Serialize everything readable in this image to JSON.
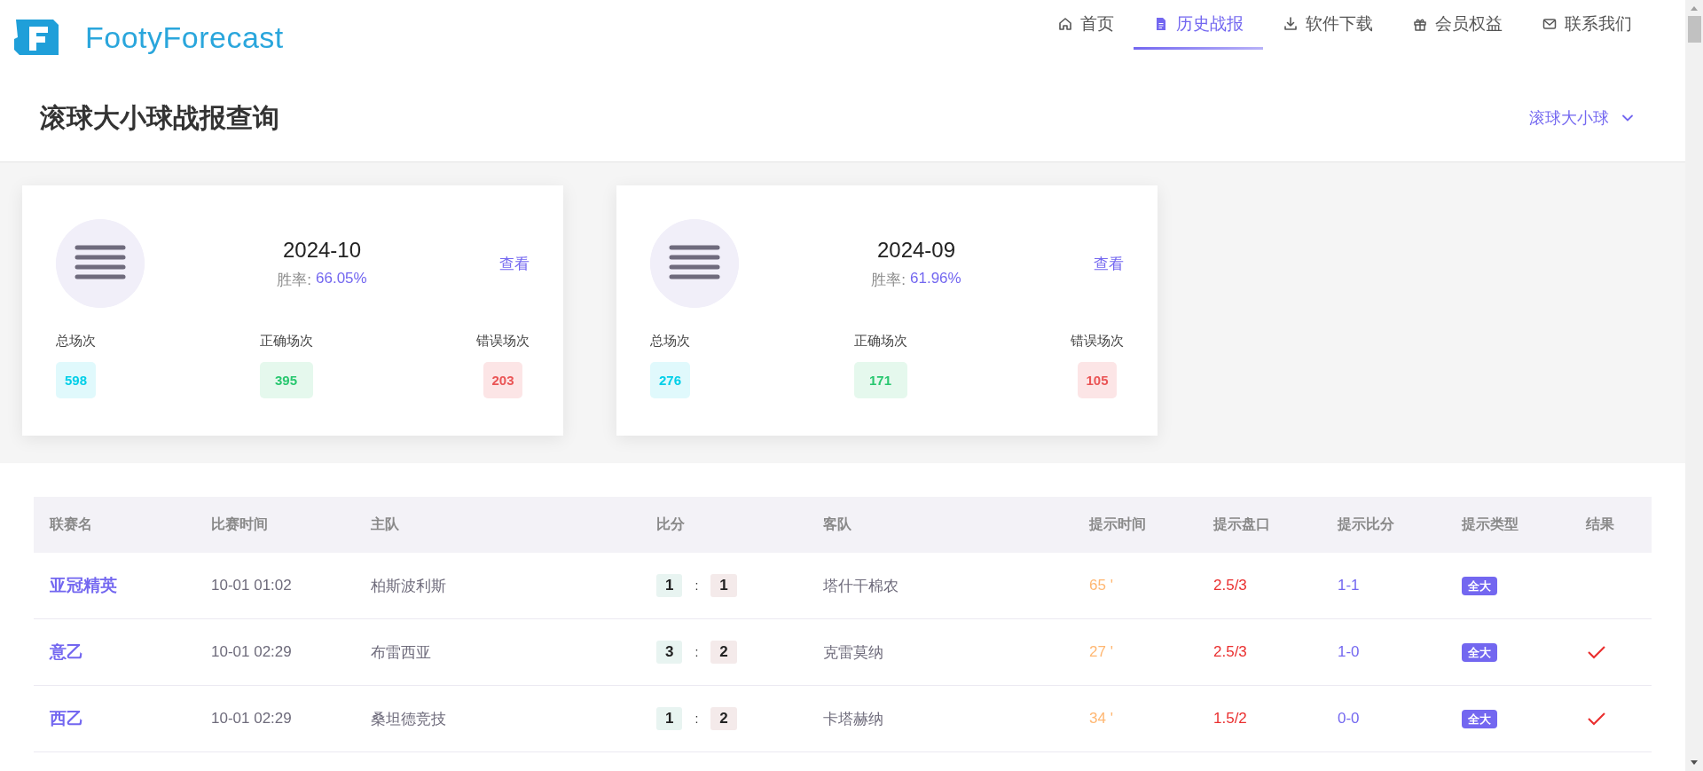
{
  "brand": {
    "name": "FootyForecast"
  },
  "nav": [
    {
      "label": "首页",
      "kind": "home",
      "selected": false
    },
    {
      "label": "历史战报",
      "kind": "doc",
      "selected": true
    },
    {
      "label": "软件下载",
      "kind": "download",
      "selected": false
    },
    {
      "label": "会员权益",
      "kind": "gift",
      "selected": false
    },
    {
      "label": "联系我们",
      "kind": "mail",
      "selected": false
    }
  ],
  "page": {
    "title": "滚球大小球战报查询",
    "dropdown": "滚球大小球"
  },
  "cards": [
    {
      "month": "2024-10",
      "rate_label": "胜率:",
      "rate": "66.05%",
      "link": "查看",
      "stats": [
        {
          "label": "总场次",
          "value": "598",
          "kind": "total"
        },
        {
          "label": "正确场次",
          "value": "395",
          "kind": "correct"
        },
        {
          "label": "错误场次",
          "value": "203",
          "kind": "wrong"
        }
      ]
    },
    {
      "month": "2024-09",
      "rate_label": "胜率:",
      "rate": "61.96%",
      "link": "查看",
      "stats": [
        {
          "label": "总场次",
          "value": "276",
          "kind": "total"
        },
        {
          "label": "正确场次",
          "value": "171",
          "kind": "correct"
        },
        {
          "label": "错误场次",
          "value": "105",
          "kind": "wrong"
        }
      ]
    }
  ],
  "table": {
    "columns": [
      "联赛名",
      "比赛时间",
      "主队",
      "比分",
      "客队",
      "提示时间",
      "提示盘口",
      "提示比分",
      "提示类型",
      "结果"
    ],
    "rows": [
      {
        "league": "亚冠精英",
        "time": "10-01 01:02",
        "home": "柏斯波利斯",
        "home_score": "1",
        "separator": ":",
        "away_score": "1",
        "away": "塔什干棉农",
        "tip_time": "65 '",
        "tip_line": "2.5/3",
        "tip_score": "1-1",
        "tip_type": "全大",
        "correct": false
      },
      {
        "league": "意乙",
        "time": "10-01 02:29",
        "home": "布雷西亚",
        "home_score": "3",
        "separator": ":",
        "away_score": "2",
        "away": "克雷莫纳",
        "tip_time": "27 '",
        "tip_line": "2.5/3",
        "tip_score": "1-0",
        "tip_type": "全大",
        "correct": true
      },
      {
        "league": "西乙",
        "time": "10-01 02:29",
        "home": "桑坦德竞技",
        "home_score": "1",
        "separator": ":",
        "away_score": "2",
        "away": "卡塔赫纳",
        "tip_time": "34 '",
        "tip_line": "1.5/2",
        "tip_score": "0-0",
        "tip_type": "全大",
        "correct": true
      }
    ]
  }
}
